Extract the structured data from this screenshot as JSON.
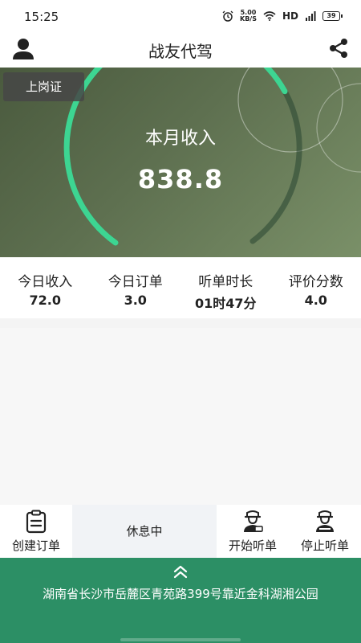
{
  "status_bar": {
    "time": "15:25",
    "speed_value": "5.00",
    "speed_unit": "KB/S",
    "network": "HD",
    "battery": "39",
    "icons": [
      "alarm-icon",
      "wifi-icon",
      "signal-icon",
      "battery-icon"
    ]
  },
  "header": {
    "title": "战友代驾",
    "left_icon": "user-icon",
    "right_icon": "share-icon"
  },
  "hero": {
    "badge": "上岗证",
    "label": "本月收入",
    "value": "838.8",
    "accent_color": "#3ddc97"
  },
  "stats": [
    {
      "label": "今日收入",
      "value": "72.0"
    },
    {
      "label": "今日订单",
      "value": "3.0"
    },
    {
      "label": "听单时长",
      "value": "01时47分"
    },
    {
      "label": "评价分数",
      "value": "4.0"
    }
  ],
  "toolbar": {
    "create_order": "创建订单",
    "status": "休息中",
    "start_listen": "开始听单",
    "stop_listen": "停止听单"
  },
  "footer": {
    "address": "湖南省长沙市岳麓区青苑路399号靠近金科湖湘公园",
    "chevron_icon": "chevron-up-double-icon",
    "color": "#2c8f65"
  }
}
